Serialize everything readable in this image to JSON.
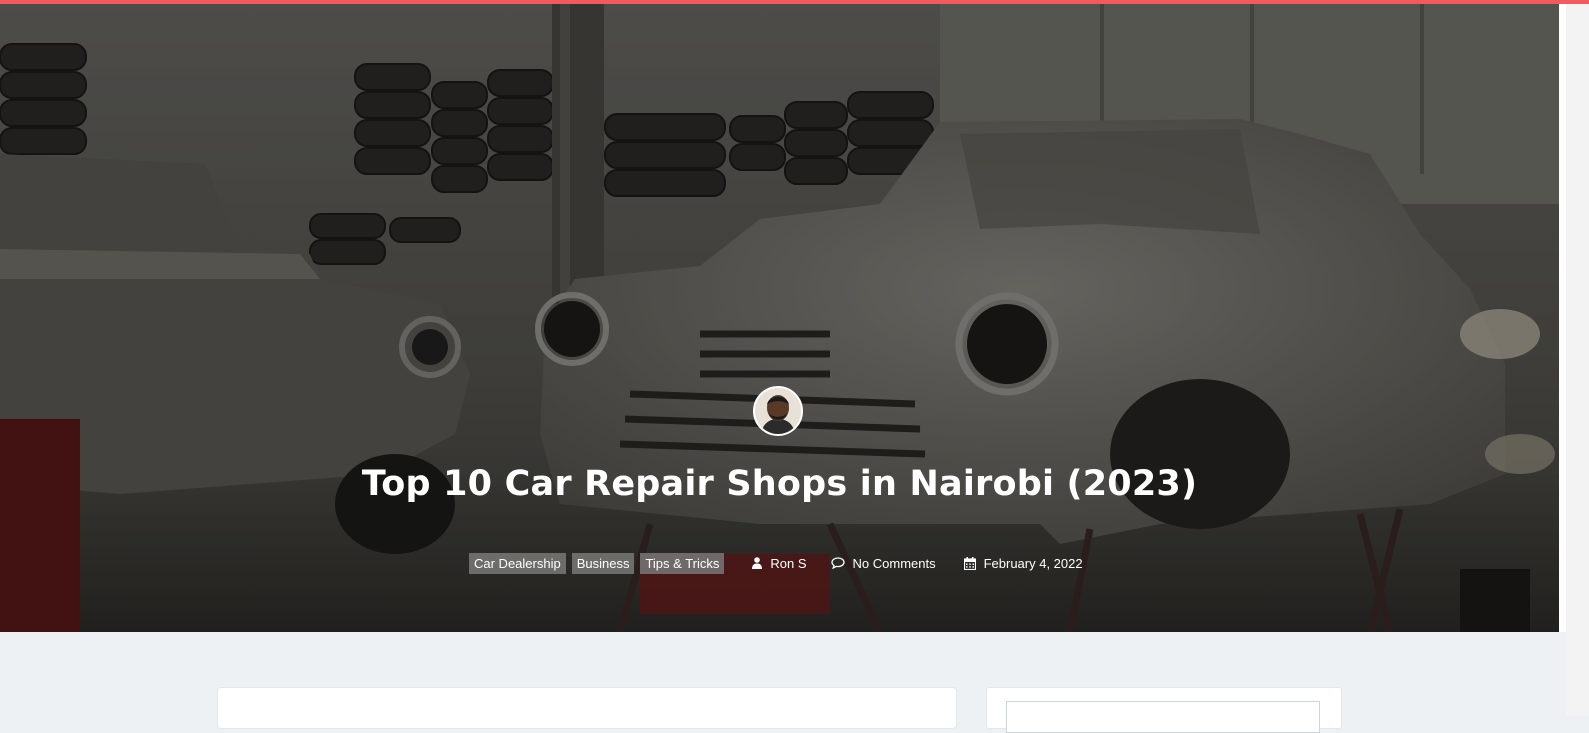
{
  "post": {
    "title": "Top 10 Car Repair Shops in Nairobi (2023)",
    "categories": [
      "Car Dealership",
      "Business",
      "Tips & Tricks"
    ],
    "author": "Ron S",
    "comments": "No Comments",
    "date": "February 4, 2022"
  },
  "icons": {
    "author": "user-icon",
    "comments": "comment-bubble-icon",
    "date": "calendar-icon"
  },
  "colors": {
    "accent_bar": "#f25a5f",
    "page_background": "#eef1f4",
    "category_badge": "#787878"
  }
}
